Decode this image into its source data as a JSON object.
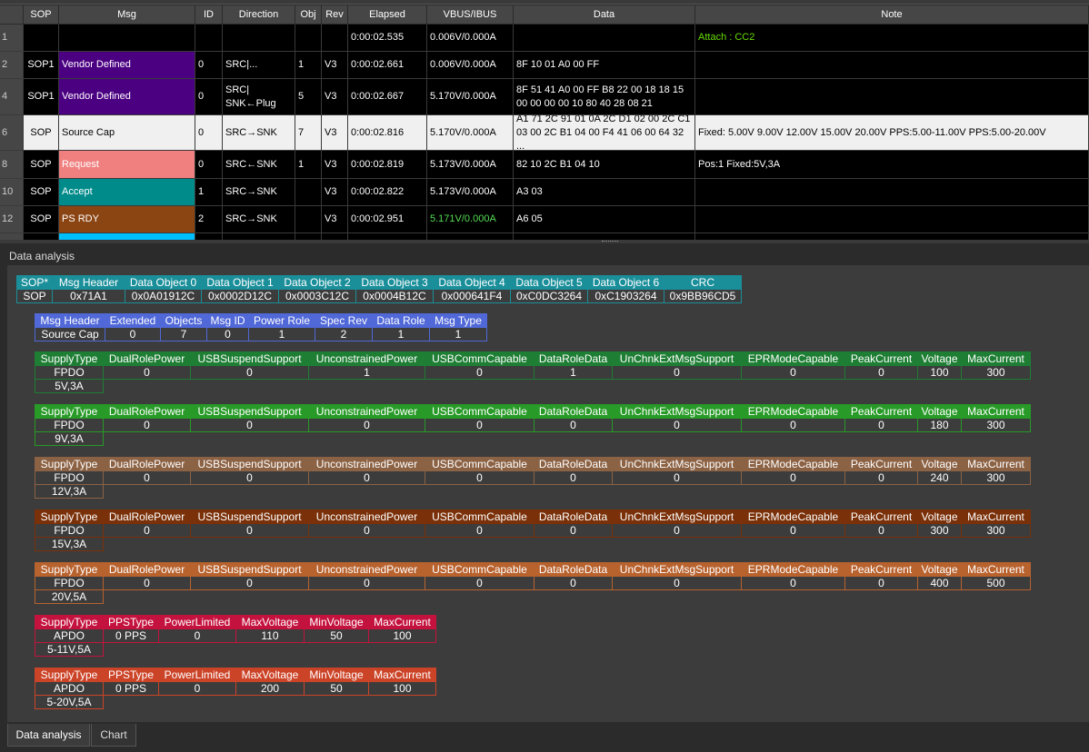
{
  "grid": {
    "columns": [
      "",
      "SOP",
      "Msg",
      "ID",
      "Direction",
      "Obj",
      "Rev",
      "Elapsed",
      "VBUS/IBUS",
      "Data",
      "Note"
    ],
    "rows": [
      {
        "n": "1",
        "sop": "",
        "msg": "",
        "msg_color": "#000000",
        "id": "",
        "dir": "",
        "obj": "",
        "rev": "",
        "elapsed": "0:00:02.535",
        "vbus": "0.006V/0.000A",
        "data": "",
        "note": "Attach : CC2",
        "note_color": "#66dd00"
      },
      {
        "n": "2",
        "sop": "SOP1",
        "msg": "Vendor Defined",
        "msg_color": "#4b0082",
        "id": "0",
        "dir": "SRC|...",
        "obj": "1",
        "rev": "V3",
        "elapsed": "0:00:02.661",
        "vbus": "0.006V/0.000A",
        "data": "8F 10 01 A0 00 FF",
        "note": ""
      },
      {
        "n": "4",
        "sop": "SOP1",
        "msg": "Vendor Defined",
        "msg_color": "#4b0082",
        "id": "0",
        "dir": "SRC|\nSNK←Plug",
        "obj": "5",
        "rev": "V3",
        "elapsed": "0:00:02.667",
        "vbus": "5.170V/0.000A",
        "data": "8F 51 41 A0 00 FF B8 22 00 18 18 15\n00 00 00 00 10 80 40 28 08 21",
        "note": ""
      },
      {
        "n": "6",
        "sop": "SOP",
        "msg": "Source Cap",
        "msg_color": "#f0f0f0",
        "id": "0",
        "dir": "SRC→SNK",
        "obj": "7",
        "rev": "V3",
        "elapsed": "0:00:02.816",
        "vbus": "5.170V/0.000A",
        "data": "A1 71 2C 91 01 0A 2C D1 02 00 2C C1\n03 00 2C B1 04 00 F4 41 06 00 64 32 ...",
        "note": "Fixed: 5.00V  9.00V  12.00V  15.00V  20.00V  PPS:5.00-11.00V  PPS:5.00-20.00V",
        "selected": true
      },
      {
        "n": "8",
        "sop": "SOP",
        "msg": "Request",
        "msg_color": "#f08080",
        "id": "0",
        "dir": "SRC←SNK",
        "obj": "1",
        "rev": "V3",
        "elapsed": "0:00:02.819",
        "vbus": "5.173V/0.000A",
        "data": "82 10 2C B1 04 10",
        "note": "Pos:1 Fixed:5V,3A"
      },
      {
        "n": "10",
        "sop": "SOP",
        "msg": "Accept",
        "msg_color": "#008b8b",
        "id": "1",
        "dir": "SRC→SNK",
        "obj": "",
        "rev": "V3",
        "elapsed": "0:00:02.822",
        "vbus": "5.173V/0.000A",
        "data": "A3 03",
        "note": ""
      },
      {
        "n": "12",
        "sop": "SOP",
        "msg": "PS RDY",
        "msg_color": "#8b4513",
        "id": "2",
        "dir": "SRC→SNK",
        "obj": "",
        "rev": "V3",
        "elapsed": "0:00:02.951",
        "vbus": "5.171V/0.000A",
        "vbus_color": "#55dd55",
        "data": "A6 05",
        "note": ""
      },
      {
        "n": "",
        "sop": "",
        "msg": "",
        "msg_color": "#00bfff",
        "id": "",
        "dir": "",
        "obj": "",
        "rev": "",
        "elapsed": "",
        "vbus": "",
        "data": "",
        "note": ""
      }
    ]
  },
  "analysis_label": "Data analysis",
  "sop_table": {
    "color": "#1a8f9a",
    "headers": [
      "SOP*",
      "Msg Header",
      "Data Object 0",
      "Data Object 1",
      "Data Object 2",
      "Data Object 3",
      "Data Object 4",
      "Data Object 5",
      "Data Object 6",
      "CRC"
    ],
    "values": [
      "SOP",
      "0x71A1",
      "0x0A01912C",
      "0x0002D12C",
      "0x0003C12C",
      "0x0004B12C",
      "0x000641F4",
      "0xC0DC3264",
      "0xC1903264",
      "0x9BB96CD5"
    ]
  },
  "header_table": {
    "color": "#5068d8",
    "headers": [
      "Msg Header",
      "Extended",
      "Objects",
      "Msg ID",
      "Power Role",
      "Spec Rev",
      "Data Role",
      "Msg Type"
    ],
    "values": [
      "Source Cap",
      "0",
      "7",
      "0",
      "1",
      "2",
      "1",
      "1"
    ]
  },
  "pdos": [
    {
      "color": "#1e7e34",
      "headers": [
        "SupplyType",
        "DualRolePower",
        "USBSuspendSupport",
        "UnconstrainedPower",
        "USBCommCapable",
        "DataRoleData",
        "UnChnkExtMsgSupport",
        "EPRModeCapable",
        "PeakCurrent",
        "Voltage",
        "MaxCurrent"
      ],
      "values": [
        "FPDO",
        "0",
        "0",
        "1",
        "0",
        "1",
        "0",
        "0",
        "0",
        "100",
        "300"
      ],
      "label": "5V,3A"
    },
    {
      "color": "#279a27",
      "headers": [
        "SupplyType",
        "DualRolePower",
        "USBSuspendSupport",
        "UnconstrainedPower",
        "USBCommCapable",
        "DataRoleData",
        "UnChnkExtMsgSupport",
        "EPRModeCapable",
        "PeakCurrent",
        "Voltage",
        "MaxCurrent"
      ],
      "values": [
        "FPDO",
        "0",
        "0",
        "0",
        "0",
        "0",
        "0",
        "0",
        "0",
        "180",
        "300"
      ],
      "label": "9V,3A"
    },
    {
      "color": "#8c6244",
      "headers": [
        "SupplyType",
        "DualRolePower",
        "USBSuspendSupport",
        "UnconstrainedPower",
        "USBCommCapable",
        "DataRoleData",
        "UnChnkExtMsgSupport",
        "EPRModeCapable",
        "PeakCurrent",
        "Voltage",
        "MaxCurrent"
      ],
      "values": [
        "FPDO",
        "0",
        "0",
        "0",
        "0",
        "0",
        "0",
        "0",
        "0",
        "240",
        "300"
      ],
      "label": "12V,3A"
    },
    {
      "color": "#7a3008",
      "headers": [
        "SupplyType",
        "DualRolePower",
        "USBSuspendSupport",
        "UnconstrainedPower",
        "USBCommCapable",
        "DataRoleData",
        "UnChnkExtMsgSupport",
        "EPRModeCapable",
        "PeakCurrent",
        "Voltage",
        "MaxCurrent"
      ],
      "values": [
        "FPDO",
        "0",
        "0",
        "0",
        "0",
        "0",
        "0",
        "0",
        "0",
        "300",
        "300"
      ],
      "label": "15V,3A"
    },
    {
      "color": "#b8622e",
      "headers": [
        "SupplyType",
        "DualRolePower",
        "USBSuspendSupport",
        "UnconstrainedPower",
        "USBCommCapable",
        "DataRoleData",
        "UnChnkExtMsgSupport",
        "EPRModeCapable",
        "PeakCurrent",
        "Voltage",
        "MaxCurrent"
      ],
      "values": [
        "FPDO",
        "0",
        "0",
        "0",
        "0",
        "0",
        "0",
        "0",
        "0",
        "400",
        "500"
      ],
      "label": "20V,5A"
    },
    {
      "color": "#c4123e",
      "headers": [
        "SupplyType",
        "PPSType",
        "PowerLimited",
        "MaxVoltage",
        "MinVoltage",
        "MaxCurrent"
      ],
      "values": [
        "APDO",
        "0 PPS",
        "0",
        "110",
        "50",
        "100"
      ],
      "label": "5-11V,5A"
    },
    {
      "color": "#cc4428",
      "headers": [
        "SupplyType",
        "PPSType",
        "PowerLimited",
        "MaxVoltage",
        "MinVoltage",
        "MaxCurrent"
      ],
      "values": [
        "APDO",
        "0 PPS",
        "0",
        "200",
        "50",
        "100"
      ],
      "label": "5-20V,5A"
    }
  ],
  "tabs": [
    {
      "label": "Data analysis",
      "active": true
    },
    {
      "label": "Chart",
      "active": false
    }
  ]
}
